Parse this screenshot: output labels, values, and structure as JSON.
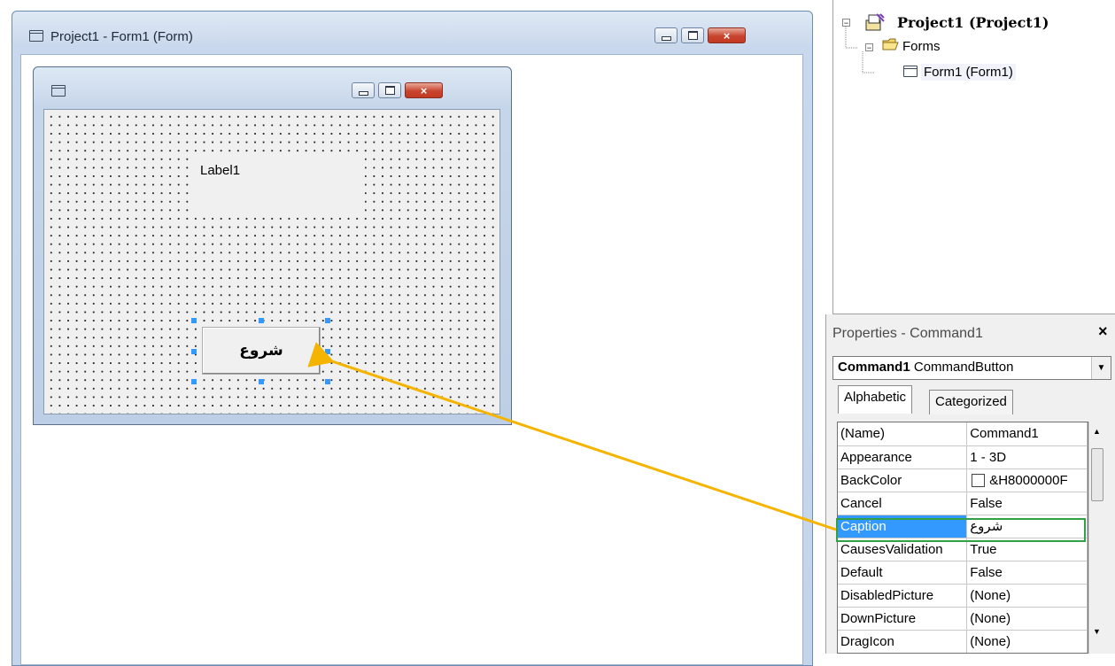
{
  "designer": {
    "title": "Project1 - Form1 (Form)"
  },
  "form": {
    "label_caption": "Label1",
    "button_caption": "شروع"
  },
  "project_explorer": {
    "root": "Project1 (Project1)",
    "folder": "Forms",
    "item": "Form1 (Form1)",
    "expand_glyph": "−"
  },
  "properties": {
    "title": "Properties - Command1",
    "close_glyph": "×",
    "object_name": "Command1",
    "object_type": "CommandButton",
    "combo_arrow": "▼",
    "tabs": [
      "Alphabetic",
      "Categorized"
    ],
    "rows": [
      {
        "name": "(Name)",
        "value": "Command1"
      },
      {
        "name": "Appearance",
        "value": "1 - 3D"
      },
      {
        "name": "BackColor",
        "value": "&H8000000F"
      },
      {
        "name": "Cancel",
        "value": "False"
      },
      {
        "name": "Caption",
        "value": "شروع"
      },
      {
        "name": "CausesValidation",
        "value": "True"
      },
      {
        "name": "Default",
        "value": "False"
      },
      {
        "name": "DisabledPicture",
        "value": "(None)"
      },
      {
        "name": "DownPicture",
        "value": "(None)"
      },
      {
        "name": "DragIcon",
        "value": "(None)"
      }
    ],
    "scroll_up": "▲",
    "scroll_down": "▼"
  },
  "colors": {
    "selection": "#3399ff",
    "highlight_box": "#31a046",
    "annotation_arrow": "#f5b400",
    "close_button": "#c8442e"
  }
}
